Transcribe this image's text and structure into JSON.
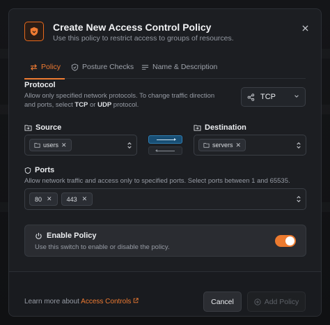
{
  "header": {
    "title": "Create New Access Control Policy",
    "subtitle": "Use this policy to restrict access to groups of resources."
  },
  "tabs": [
    {
      "label": "Policy",
      "icon": "arrows-icon",
      "active": true
    },
    {
      "label": "Posture Checks",
      "icon": "shield-check-icon",
      "active": false
    },
    {
      "label": "Name & Description",
      "icon": "text-lines-icon",
      "active": false
    }
  ],
  "protocol": {
    "label": "Protocol",
    "help_part1": "Allow only specified network protocols. To change traffic direction and ports, select ",
    "tcp": "TCP",
    "or": " or ",
    "udp": "UDP",
    "help_part2": " protocol.",
    "selected": "TCP"
  },
  "source": {
    "label": "Source",
    "chips": [
      "users"
    ]
  },
  "destination": {
    "label": "Destination",
    "chips": [
      "servers"
    ]
  },
  "ports": {
    "label": "Ports",
    "help": "Allow network traffic and access only to specified ports. Select ports between 1 and 65535.",
    "chips": [
      "80",
      "443"
    ]
  },
  "enable": {
    "title": "Enable Policy",
    "help": "Use this switch to enable or disable the policy.",
    "enabled": true
  },
  "footer": {
    "learn_prefix": "Learn more about ",
    "learn_link": "Access Controls",
    "cancel": "Cancel",
    "add": "Add Policy"
  },
  "colors": {
    "accent": "#ef7b32",
    "direction_active": "#184e74",
    "background": "#1c1e22"
  }
}
